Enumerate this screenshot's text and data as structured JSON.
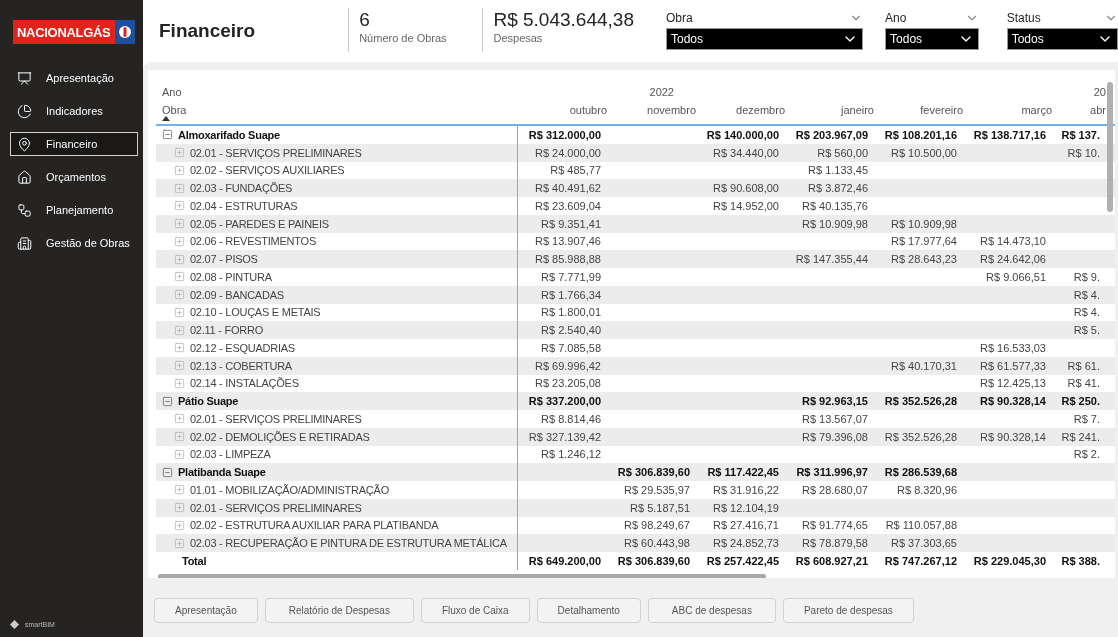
{
  "brand": {
    "name": "NACIONALGÁS"
  },
  "sidebar": {
    "items": [
      {
        "label": "Apresentação",
        "selected": false
      },
      {
        "label": "Indicadores",
        "selected": false
      },
      {
        "label": "Financeiro",
        "selected": true
      },
      {
        "label": "Orçamentos",
        "selected": false
      },
      {
        "label": "Planejamento",
        "selected": false
      },
      {
        "label": "Gestão de Obras",
        "selected": false
      }
    ],
    "footer_logo": "smartBIM"
  },
  "page_title": "Financeiro",
  "kpis": [
    {
      "value": "6",
      "label": "Número de Obras"
    },
    {
      "value": "R$ 5.043.644,38",
      "label": "Despesas"
    }
  ],
  "filters": [
    {
      "label": "Obra",
      "value": "Todos"
    },
    {
      "label": "Ano",
      "value": "Todos"
    },
    {
      "label": "Status",
      "value": "Todos"
    }
  ],
  "table": {
    "year_label": "Ano",
    "row_header": "Obra",
    "columns": [
      {
        "month": "outubro"
      },
      {
        "year": "2022",
        "month": "novembro"
      },
      {
        "month": "dezembro"
      },
      {
        "month": "janeiro"
      },
      {
        "month": "fevereiro"
      },
      {
        "month": "março"
      },
      {
        "year": "20",
        "month": "abr"
      }
    ],
    "rows": [
      {
        "kind": "group",
        "label": "Almoxarifado Suape",
        "expanded": true,
        "values": {
          "col_1": "R$ 312.000,00",
          "col_3": "R$ 140.000,00",
          "col_4": "R$ 203.967,09",
          "col_5": "R$ 108.201,16",
          "col_6": "R$ 138.717,16",
          "col_7": "R$ 137."
        }
      },
      {
        "kind": "item",
        "label": "02.01 - SERVIÇOS PRELIMINARES",
        "expanded": false,
        "values": {
          "col_1": "R$ 24.000,00",
          "col_3": "R$ 34.440,00",
          "col_4": "R$ 560,00",
          "col_5": "R$ 10.500,00",
          "col_7": "R$ 10."
        }
      },
      {
        "kind": "item",
        "label": "02.02 - SERVIÇOS AUXILIARES",
        "expanded": false,
        "values": {
          "col_1": "R$ 485,77",
          "col_4": "R$ 1.133,45"
        }
      },
      {
        "kind": "item",
        "label": "02.03 - FUNDAÇÕES",
        "expanded": false,
        "values": {
          "col_1": "R$ 40.491,62",
          "col_3": "R$ 90.608,00",
          "col_4": "R$ 3.872,46"
        }
      },
      {
        "kind": "item",
        "label": "02.04 - ESTRUTURAS",
        "expanded": false,
        "values": {
          "col_1": "R$ 23.609,04",
          "col_3": "R$ 14.952,00",
          "col_4": "R$ 40.135,76"
        }
      },
      {
        "kind": "item",
        "label": "02.05 - PAREDES E PAINEIS",
        "expanded": false,
        "values": {
          "col_1": "R$ 9.351,41",
          "col_4": "R$ 10.909,98",
          "col_5": "R$ 10.909,98"
        }
      },
      {
        "kind": "item",
        "label": "02.06 - REVESTIMENTOS",
        "expanded": false,
        "values": {
          "col_1": "R$ 13.907,46",
          "col_5": "R$ 17.977,64",
          "col_6": "R$ 14.473,10"
        }
      },
      {
        "kind": "item",
        "label": "02.07 - PISOS",
        "expanded": false,
        "values": {
          "col_1": "R$ 85.988,88",
          "col_4": "R$ 147.355,44",
          "col_5": "R$ 28.643,23",
          "col_6": "R$ 24.642,06"
        }
      },
      {
        "kind": "item",
        "label": "02.08 - PINTURA",
        "expanded": false,
        "values": {
          "col_1": "R$ 7.771,99",
          "col_6": "R$ 9.066,51",
          "col_7": "R$ 9."
        }
      },
      {
        "kind": "item",
        "label": "02.09 - BANCADAS",
        "expanded": false,
        "values": {
          "col_1": "R$ 1.766,34",
          "col_7": "R$ 4."
        }
      },
      {
        "kind": "item",
        "label": "02.10 - LOUÇAS E METAIS",
        "expanded": false,
        "values": {
          "col_1": "R$ 1.800,01",
          "col_7": "R$ 4."
        }
      },
      {
        "kind": "item",
        "label": "02.11 - FORRO",
        "expanded": false,
        "values": {
          "col_1": "R$ 2.540,40",
          "col_7": "R$ 5."
        }
      },
      {
        "kind": "item",
        "label": "02.12 - ESQUADRIAS",
        "expanded": false,
        "values": {
          "col_1": "R$ 7.085,58",
          "col_6": "R$ 16.533,03"
        }
      },
      {
        "kind": "item",
        "label": "02.13 - COBERTURA",
        "expanded": false,
        "values": {
          "col_1": "R$ 69.996,42",
          "col_5": "R$ 40.170,31",
          "col_6": "R$ 61.577,33",
          "col_7": "R$ 61."
        }
      },
      {
        "kind": "item",
        "label": "02.14 - INSTALAÇÕES",
        "expanded": false,
        "values": {
          "col_1": "R$ 23.205,08",
          "col_6": "R$ 12.425,13",
          "col_7": "R$ 41."
        }
      },
      {
        "kind": "group",
        "label": "Pátio Suape",
        "expanded": true,
        "values": {
          "col_1": "R$ 337.200,00",
          "col_4": "R$ 92.963,15",
          "col_5": "R$ 352.526,28",
          "col_6": "R$ 90.328,14",
          "col_7": "R$ 250."
        }
      },
      {
        "kind": "item",
        "label": "02.01 - SERVIÇOS PRELIMINARES",
        "expanded": false,
        "values": {
          "col_1": "R$ 8.814,46",
          "col_4": "R$ 13.567,07",
          "col_7": "R$ 7."
        }
      },
      {
        "kind": "item",
        "label": "02.02 - DEMOLIÇÕES E RETIRADAS",
        "expanded": false,
        "values": {
          "col_1": "R$ 327.139,42",
          "col_4": "R$ 79.396,08",
          "col_5": "R$ 352.526,28",
          "col_6": "R$ 90.328,14",
          "col_7": "R$ 241."
        }
      },
      {
        "kind": "item",
        "label": "02.03 - LIMPEZA",
        "expanded": false,
        "values": {
          "col_1": "R$ 1.246,12",
          "col_7": "R$ 2."
        }
      },
      {
        "kind": "group",
        "label": "Platibanda Suape",
        "expanded": true,
        "values": {
          "col_2": "R$ 306.839,60",
          "col_3": "R$ 117.422,45",
          "col_4": "R$ 311.996,97",
          "col_5": "R$ 286.539,68"
        }
      },
      {
        "kind": "item",
        "label": "01.01 - MOBILIZAÇÃO/ADMINISTRAÇÃO",
        "expanded": false,
        "values": {
          "col_2": "R$ 29.535,97",
          "col_3": "R$ 31.916,22",
          "col_4": "R$ 28.680,07",
          "col_5": "R$ 8.320,96"
        }
      },
      {
        "kind": "item",
        "label": "02.01 - SERVIÇOS PRELIMINARES",
        "expanded": false,
        "values": {
          "col_2": "R$ 5.187,51",
          "col_3": "R$ 12.104,19"
        }
      },
      {
        "kind": "item",
        "label": "02.02 - ESTRUTURA AUXILIAR PARA PLATIBANDA",
        "expanded": false,
        "values": {
          "col_2": "R$ 98.249,67",
          "col_3": "R$ 27.416,71",
          "col_4": "R$ 91.774,65",
          "col_5": "R$ 110.057,88"
        }
      },
      {
        "kind": "item",
        "label": "02.03 - RECUPERAÇÃO E PINTURA DE ESTRUTURA METÁLICA",
        "expanded": false,
        "values": {
          "col_2": "R$ 60.443,98",
          "col_3": "R$ 24.852,73",
          "col_4": "R$ 78.879,58",
          "col_5": "R$ 37.303,65"
        }
      },
      {
        "kind": "total",
        "label": "Total",
        "values": {
          "col_1": "R$ 649.200,00",
          "col_2": "R$ 306.839,60",
          "col_3": "R$ 257.422,45",
          "col_4": "R$ 608.927,21",
          "col_5": "R$ 747.267,12",
          "col_6": "R$ 229.045,30",
          "col_7": "R$ 388."
        }
      }
    ]
  },
  "nav_buttons": [
    "Apresentação",
    "Relatório de Despesas",
    "Fluxo de Caixa",
    "Detalhamento",
    "ABC de despesas",
    "Pareto de despesas"
  ]
}
